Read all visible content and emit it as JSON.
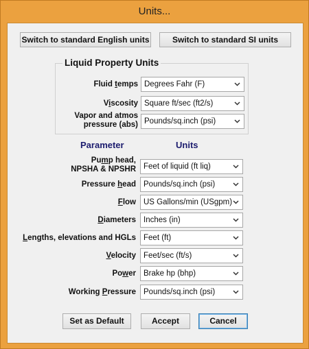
{
  "window": {
    "title": "Units..."
  },
  "top_buttons": {
    "english": "Switch to standard English units",
    "si": "Switch to standard SI units"
  },
  "liquid_group": {
    "title": "Liquid Property Units",
    "rows": [
      {
        "label_parts": [
          "Fluid ",
          "t",
          "emps"
        ],
        "value": "Degrees Fahr (F)"
      },
      {
        "label_parts": [
          "V",
          "i",
          "scosity"
        ],
        "value": "Square ft/sec (ft2/s)"
      },
      {
        "label_line1": "Vapor and atmos",
        "label_line2": "pressure (abs)",
        "value": "Pounds/sq.inch (psi)"
      }
    ]
  },
  "columns": {
    "parameter": "Parameter",
    "units": "Units"
  },
  "param_rows": [
    {
      "label_line1_parts": [
        "Pu",
        "m",
        "p head,"
      ],
      "label_line2": "NPSHA & NPSHR",
      "value": "Feet of liquid (ft liq)"
    },
    {
      "label_parts": [
        "Pressure ",
        "h",
        "ead"
      ],
      "value": "Pounds/sq.inch (psi)"
    },
    {
      "label_parts": [
        "",
        "F",
        "low"
      ],
      "value": "US Gallons/min (USgpm)"
    },
    {
      "label_parts": [
        "",
        "D",
        "iameters"
      ],
      "value": "Inches (in)"
    },
    {
      "label_parts": [
        "",
        "L",
        "engths, elevations and HGLs"
      ],
      "value": "Feet (ft)"
    },
    {
      "label_parts": [
        "",
        "V",
        "elocity"
      ],
      "value": "Feet/sec (ft/s)"
    },
    {
      "label_parts": [
        "Po",
        "w",
        "er"
      ],
      "value": "Brake hp (bhp)"
    },
    {
      "label_parts": [
        "Working ",
        "P",
        "ressure"
      ],
      "value": "Pounds/sq.inch (psi)"
    }
  ],
  "bottom_buttons": {
    "default": "Set as Default",
    "accept": "Accept",
    "cancel": "Cancel"
  },
  "icons": {
    "dropdown": "chevron-down-icon"
  }
}
